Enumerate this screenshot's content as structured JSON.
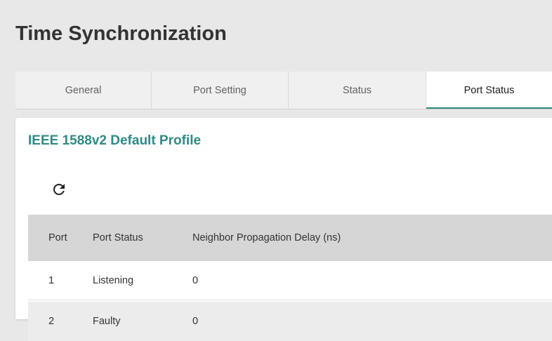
{
  "page": {
    "title": "Time Synchronization"
  },
  "tabs": [
    {
      "label": "General",
      "active": false
    },
    {
      "label": "Port Setting",
      "active": false
    },
    {
      "label": "Status",
      "active": false
    },
    {
      "label": "Port Status",
      "active": true
    }
  ],
  "card": {
    "title": "IEEE 1588v2 Default Profile",
    "refresh_icon": "refresh-icon"
  },
  "table": {
    "headers": [
      "Port",
      "Port Status",
      "Neighbor Propagation Delay (ns)"
    ],
    "rows": [
      {
        "port": "1",
        "status": "Listening",
        "delay": "0"
      },
      {
        "port": "2",
        "status": "Faulty",
        "delay": "0"
      }
    ]
  },
  "colors": {
    "accent": "#2f8a85",
    "page_background": "#e8e8e8",
    "table_header_background": "#d6d6d6"
  }
}
